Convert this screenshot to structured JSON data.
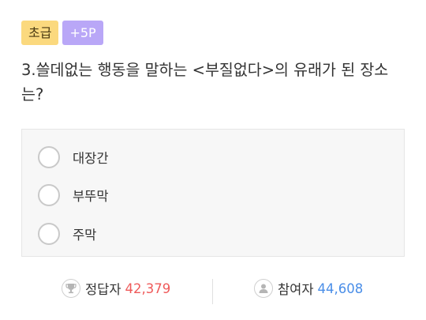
{
  "badges": {
    "level": "초급",
    "points": "+5P"
  },
  "question": {
    "text": "3.쓸데없는 행동을 말하는 <부질없다>의 유래가 된 장소는?"
  },
  "options": [
    {
      "label": "대장간",
      "selected": false
    },
    {
      "label": "부뚜막",
      "selected": false
    },
    {
      "label": "주막",
      "selected": false
    }
  ],
  "stats": {
    "correct": {
      "icon": "trophy-icon",
      "label": "정답자",
      "value": "42,379",
      "color": "#ef5a5a"
    },
    "participants": {
      "icon": "user-icon",
      "label": "참여자",
      "value": "44,608",
      "color": "#4a8ee8"
    }
  }
}
